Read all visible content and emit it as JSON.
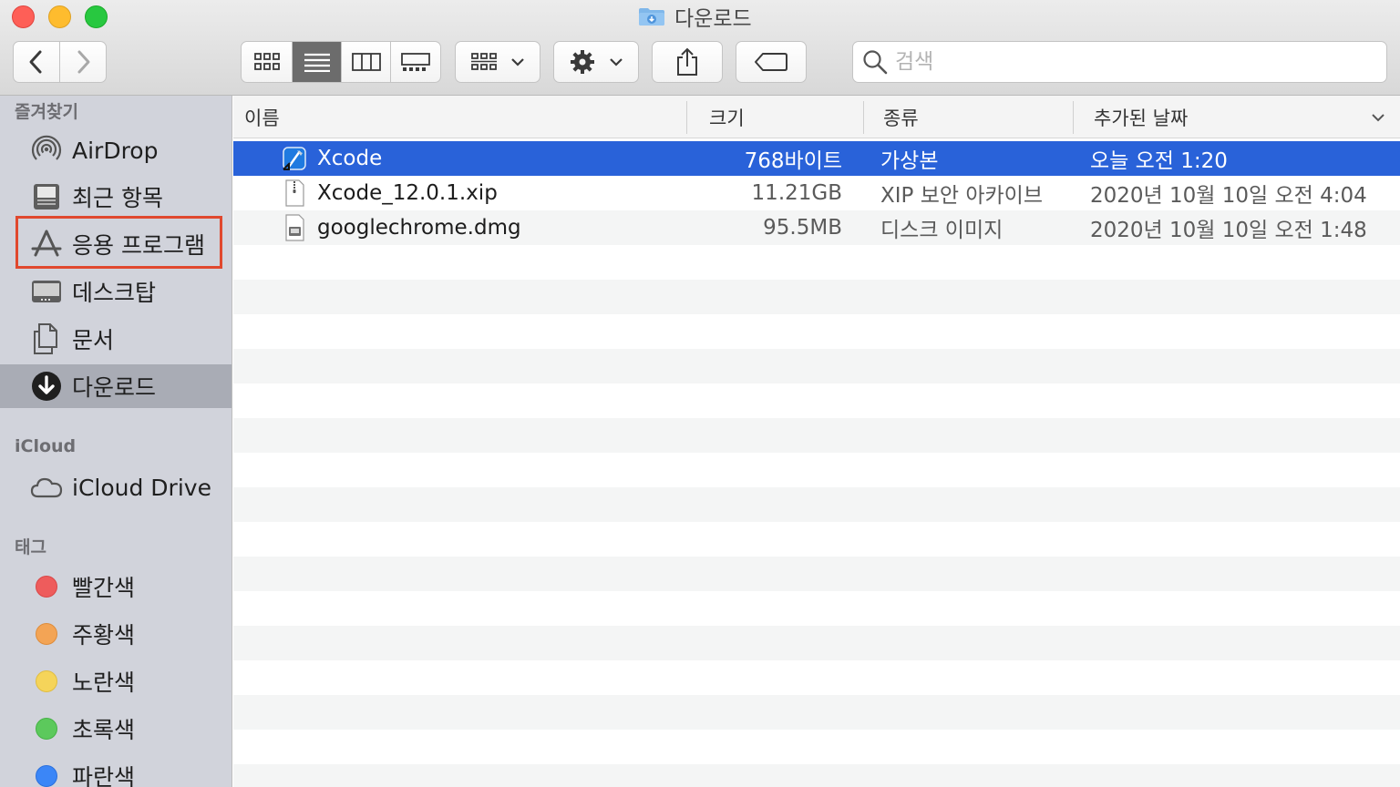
{
  "window": {
    "title": "다운로드"
  },
  "search": {
    "placeholder": "검색"
  },
  "sidebar": {
    "favorites_title": "즐겨찾기",
    "favorites": [
      {
        "label": "AirDrop",
        "icon": "airdrop-icon"
      },
      {
        "label": "최근 항목",
        "icon": "recents-icon"
      },
      {
        "label": "응용 프로그램",
        "icon": "applications-icon",
        "highlighted": true
      },
      {
        "label": "데스크탑",
        "icon": "desktop-icon"
      },
      {
        "label": "문서",
        "icon": "documents-icon"
      },
      {
        "label": "다운로드",
        "icon": "downloads-icon",
        "selected": true
      }
    ],
    "icloud_title": "iCloud",
    "icloud": [
      {
        "label": "iCloud Drive",
        "icon": "cloud-icon"
      }
    ],
    "tags_title": "태그",
    "tags": [
      {
        "label": "빨간색",
        "color": "#ee5c5c"
      },
      {
        "label": "주황색",
        "color": "#f3a455"
      },
      {
        "label": "노란색",
        "color": "#f5d45a"
      },
      {
        "label": "초록색",
        "color": "#5cc95c"
      },
      {
        "label": "파란색",
        "color": "#3b86f7"
      }
    ]
  },
  "columns": {
    "name": "이름",
    "size": "크기",
    "kind": "종류",
    "date_added": "추가된 날짜"
  },
  "files": [
    {
      "name": "Xcode",
      "size": "768바이트",
      "kind": "가상본",
      "date": "오늘 오전 1:20",
      "icon": "xcode-alias-icon",
      "selected": true
    },
    {
      "name": "Xcode_12.0.1.xip",
      "size": "11.21GB",
      "kind": "XIP 보안 아카이브",
      "date": "2020년 10월 10일 오전 4:04",
      "icon": "archive-file-icon"
    },
    {
      "name": "googlechrome.dmg",
      "size": "95.5MB",
      "kind": "디스크 이미지",
      "date": "2020년 10월 10일 오전 1:48",
      "icon": "disk-image-icon"
    }
  ],
  "colors": {
    "selection": "#2962d9",
    "sidebar_bg": "#d1d3db",
    "highlight_border": "#e0482e"
  }
}
